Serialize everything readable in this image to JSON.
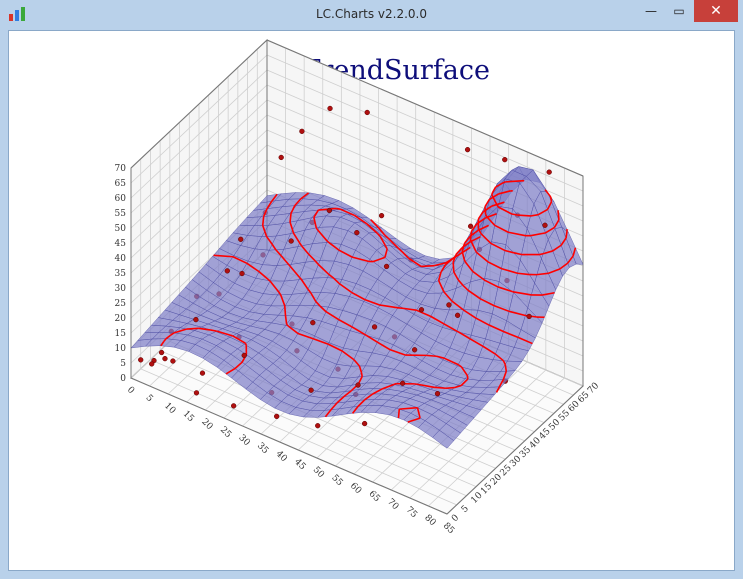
{
  "window": {
    "title": "LC.Charts v2.2.0.0",
    "controls": {
      "minimize": "—",
      "maximize": "▭",
      "close": "✕"
    }
  },
  "chart_data": {
    "type": "surface",
    "title": "3D-TrendSurface",
    "xlabel": "",
    "ylabel": "",
    "zlabel": "",
    "xlim": [
      0,
      85
    ],
    "ylim": [
      0,
      70
    ],
    "zlim": [
      0,
      70
    ],
    "x_ticks": [
      0,
      5,
      10,
      15,
      20,
      25,
      30,
      35,
      40,
      45,
      50,
      55,
      60,
      65,
      70,
      75,
      80,
      85
    ],
    "y_ticks": [
      0,
      5,
      10,
      15,
      20,
      25,
      30,
      35,
      40,
      45,
      50,
      55,
      60,
      65,
      70
    ],
    "z_ticks": [
      0,
      5,
      10,
      15,
      20,
      25,
      30,
      35,
      40,
      45,
      50,
      55,
      60,
      65,
      70
    ],
    "surface_color": "#7f80c8",
    "contour_color": "#ff0000",
    "point_color": "#b01010",
    "grid": true,
    "points": [
      [
        0,
        5,
        3
      ],
      [
        2,
        8,
        2
      ],
      [
        3,
        10,
        4
      ],
      [
        4,
        3,
        5
      ],
      [
        5,
        12,
        1
      ],
      [
        6,
        6,
        6
      ],
      [
        3,
        15,
        8
      ],
      [
        7,
        20,
        11
      ],
      [
        8,
        30,
        14
      ],
      [
        10,
        38,
        17
      ],
      [
        12,
        45,
        20
      ],
      [
        14,
        10,
        3
      ],
      [
        16,
        25,
        7
      ],
      [
        18,
        48,
        26
      ],
      [
        20,
        55,
        29
      ],
      [
        22,
        60,
        31
      ],
      [
        25,
        35,
        10
      ],
      [
        28,
        40,
        9
      ],
      [
        30,
        15,
        2
      ],
      [
        32,
        55,
        32
      ],
      [
        35,
        62,
        35
      ],
      [
        38,
        20,
        4
      ],
      [
        40,
        30,
        6
      ],
      [
        42,
        45,
        12
      ],
      [
        45,
        58,
        28
      ],
      [
        48,
        25,
        8
      ],
      [
        50,
        40,
        16
      ],
      [
        52,
        50,
        20
      ],
      [
        55,
        15,
        5
      ],
      [
        58,
        35,
        19
      ],
      [
        60,
        60,
        46
      ],
      [
        62,
        45,
        30
      ],
      [
        65,
        55,
        44
      ],
      [
        68,
        38,
        34
      ],
      [
        70,
        65,
        52
      ],
      [
        72,
        20,
        21
      ],
      [
        75,
        50,
        42
      ],
      [
        80,
        60,
        57
      ],
      [
        85,
        30,
        26
      ],
      [
        12,
        65,
        49
      ],
      [
        8,
        62,
        40
      ],
      [
        5,
        40,
        14
      ],
      [
        15,
        5,
        0
      ],
      [
        25,
        5,
        1
      ],
      [
        35,
        8,
        1
      ],
      [
        45,
        10,
        2
      ],
      [
        10,
        50,
        30
      ],
      [
        20,
        20,
        6
      ],
      [
        30,
        28,
        8
      ],
      [
        40,
        55,
        25
      ],
      [
        50,
        20,
        9
      ],
      [
        60,
        25,
        15
      ],
      [
        2,
        30,
        10
      ],
      [
        6,
        45,
        22
      ],
      [
        18,
        68,
        58
      ],
      [
        28,
        68,
        62
      ],
      [
        55,
        68,
        64
      ],
      [
        65,
        68,
        66
      ],
      [
        78,
        66,
        70
      ],
      [
        82,
        48,
        35
      ]
    ]
  }
}
